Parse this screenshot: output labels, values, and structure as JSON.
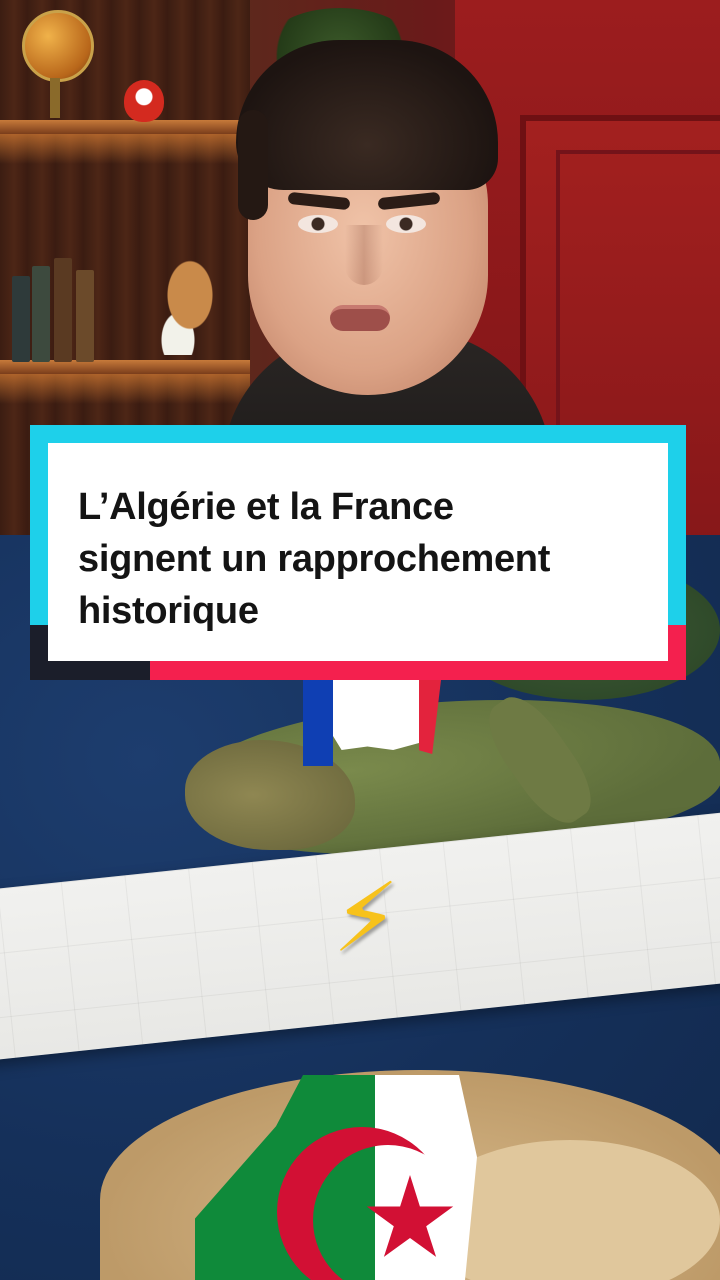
{
  "headline": {
    "line1": "L’Algérie et la France",
    "line2": "signent un rapprochement",
    "line3": "historique"
  },
  "visual": {
    "bolt_symbol": "⚡",
    "flags": [
      "france-flag",
      "algeria-flag"
    ],
    "colors": {
      "card_cyan": "#1ed0ea",
      "card_red": "#f4204e",
      "card_dark": "#1b1e2a",
      "bolt": "#f7c21b",
      "france_blue": "#0f3fb3",
      "france_red": "#e3233d",
      "algeria_green": "#0f8a3a",
      "algeria_red": "#d21034"
    }
  }
}
